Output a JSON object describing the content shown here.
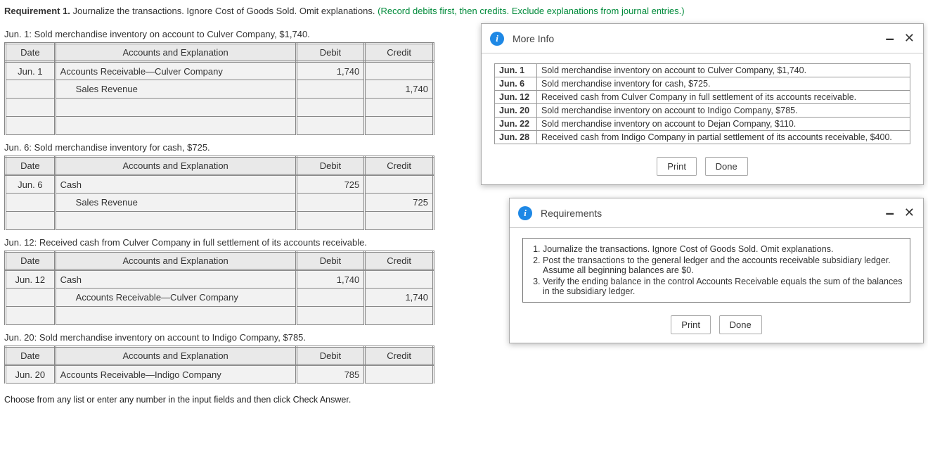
{
  "requirement": {
    "label": "Requirement 1.",
    "text": "Journalize the transactions. Ignore Cost of Goods Sold. Omit explanations.",
    "hint": "(Record debits first, then credits. Exclude explanations from journal entries.)"
  },
  "headers": {
    "date": "Date",
    "acct": "Accounts and Explanation",
    "debit": "Debit",
    "credit": "Credit"
  },
  "transactions": [
    {
      "desc": "Jun. 1: Sold merchandise inventory on account to Culver Company, $1,740.",
      "rows": [
        {
          "date": "Jun. 1",
          "acct": "Accounts Receivable—Culver Company",
          "debit": "1,740",
          "credit": ""
        },
        {
          "date": "",
          "acct": "Sales Revenue",
          "indent": true,
          "debit": "",
          "credit": "1,740"
        },
        {
          "date": "",
          "acct": "",
          "debit": "",
          "credit": ""
        },
        {
          "date": "",
          "acct": "",
          "debit": "",
          "credit": ""
        }
      ]
    },
    {
      "desc": "Jun. 6: Sold merchandise inventory for cash, $725.",
      "rows": [
        {
          "date": "Jun. 6",
          "acct": "Cash",
          "debit": "725",
          "credit": ""
        },
        {
          "date": "",
          "acct": "Sales Revenue",
          "indent": true,
          "debit": "",
          "credit": "725"
        },
        {
          "date": "",
          "acct": "",
          "debit": "",
          "credit": ""
        }
      ]
    },
    {
      "desc": "Jun. 12: Received cash from Culver Company in full settlement of its accounts receivable.",
      "rows": [
        {
          "date": "Jun. 12",
          "acct": "Cash",
          "debit": "1,740",
          "credit": ""
        },
        {
          "date": "",
          "acct": "Accounts Receivable—Culver Company",
          "indent": true,
          "debit": "",
          "credit": "1,740"
        },
        {
          "date": "",
          "acct": "",
          "debit": "",
          "credit": ""
        }
      ]
    },
    {
      "desc": "Jun. 20: Sold merchandise inventory on account to Indigo Company, $785.",
      "rows": [
        {
          "date": "Jun. 20",
          "acct": "Accounts Receivable—Indigo Company",
          "debit": "785",
          "credit": ""
        }
      ]
    }
  ],
  "footer": "Choose from any list or enter any number in the input fields and then click Check Answer.",
  "more_info": {
    "title": "More Info",
    "print": "Print",
    "done": "Done",
    "items": [
      {
        "date": "Jun. 1",
        "text": "Sold merchandise inventory on account to Culver Company, $1,740."
      },
      {
        "date": "Jun. 6",
        "text": "Sold merchandise inventory for cash, $725."
      },
      {
        "date": "Jun. 12",
        "text": "Received cash from Culver Company in full settlement of its accounts receivable."
      },
      {
        "date": "Jun. 20",
        "text": "Sold merchandise inventory on account to Indigo Company, $785."
      },
      {
        "date": "Jun. 22",
        "text": "Sold merchandise inventory on account to Dejan Company, $110."
      },
      {
        "date": "Jun. 28",
        "text": "Received cash from Indigo Company in partial settlement of its accounts receivable, $400."
      }
    ]
  },
  "requirements_panel": {
    "title": "Requirements",
    "print": "Print",
    "done": "Done",
    "items": [
      "Journalize the transactions. Ignore Cost of Goods Sold. Omit explanations.",
      "Post the transactions to the general ledger and the accounts receivable subsidiary ledger. Assume all beginning balances are $0.",
      "Verify the ending balance in the control Accounts Receivable equals the sum of the balances in the subsidiary ledger."
    ]
  }
}
